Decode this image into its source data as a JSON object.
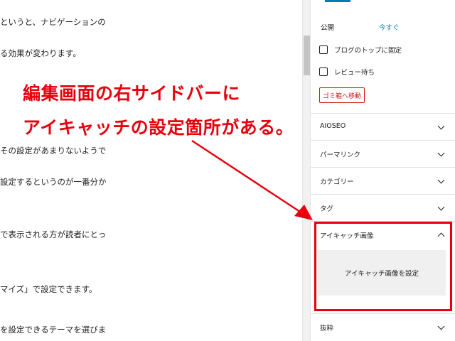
{
  "editor": {
    "lines": [
      "というと、ナビゲーションの",
      "る効果が変わります。",
      "その設定があまりないようで",
      "設定するというのが一番分か",
      "で表示される方が読者にとっ",
      "マイズ」で設定できます。",
      "を設定できるテーマを選びま"
    ]
  },
  "sidebar": {
    "publish_label": "公開",
    "publish_value": "今すぐ",
    "checkboxes": [
      {
        "label": "ブログのトップに固定",
        "checked": false
      },
      {
        "label": "レビュー待ち",
        "checked": false
      }
    ],
    "trash_button": "ゴミ箱へ移動",
    "panels": [
      {
        "label": "AIOSEO",
        "expanded": false
      },
      {
        "label": "パーマリンク",
        "expanded": false
      },
      {
        "label": "カテゴリー",
        "expanded": false
      },
      {
        "label": "タグ",
        "expanded": false
      },
      {
        "label": "アイキャッチ画像",
        "expanded": true
      },
      {
        "label": "抜粋",
        "expanded": false
      }
    ],
    "featured_image_button": "アイキャッチ画像を設定"
  },
  "annotation": {
    "line1": "編集画面の右サイドバーに",
    "line2": "アイキャッチの設定箇所がある。",
    "color": "#e8000d"
  },
  "colors": {
    "accent": "#007cba",
    "danger": "#cc1818"
  }
}
